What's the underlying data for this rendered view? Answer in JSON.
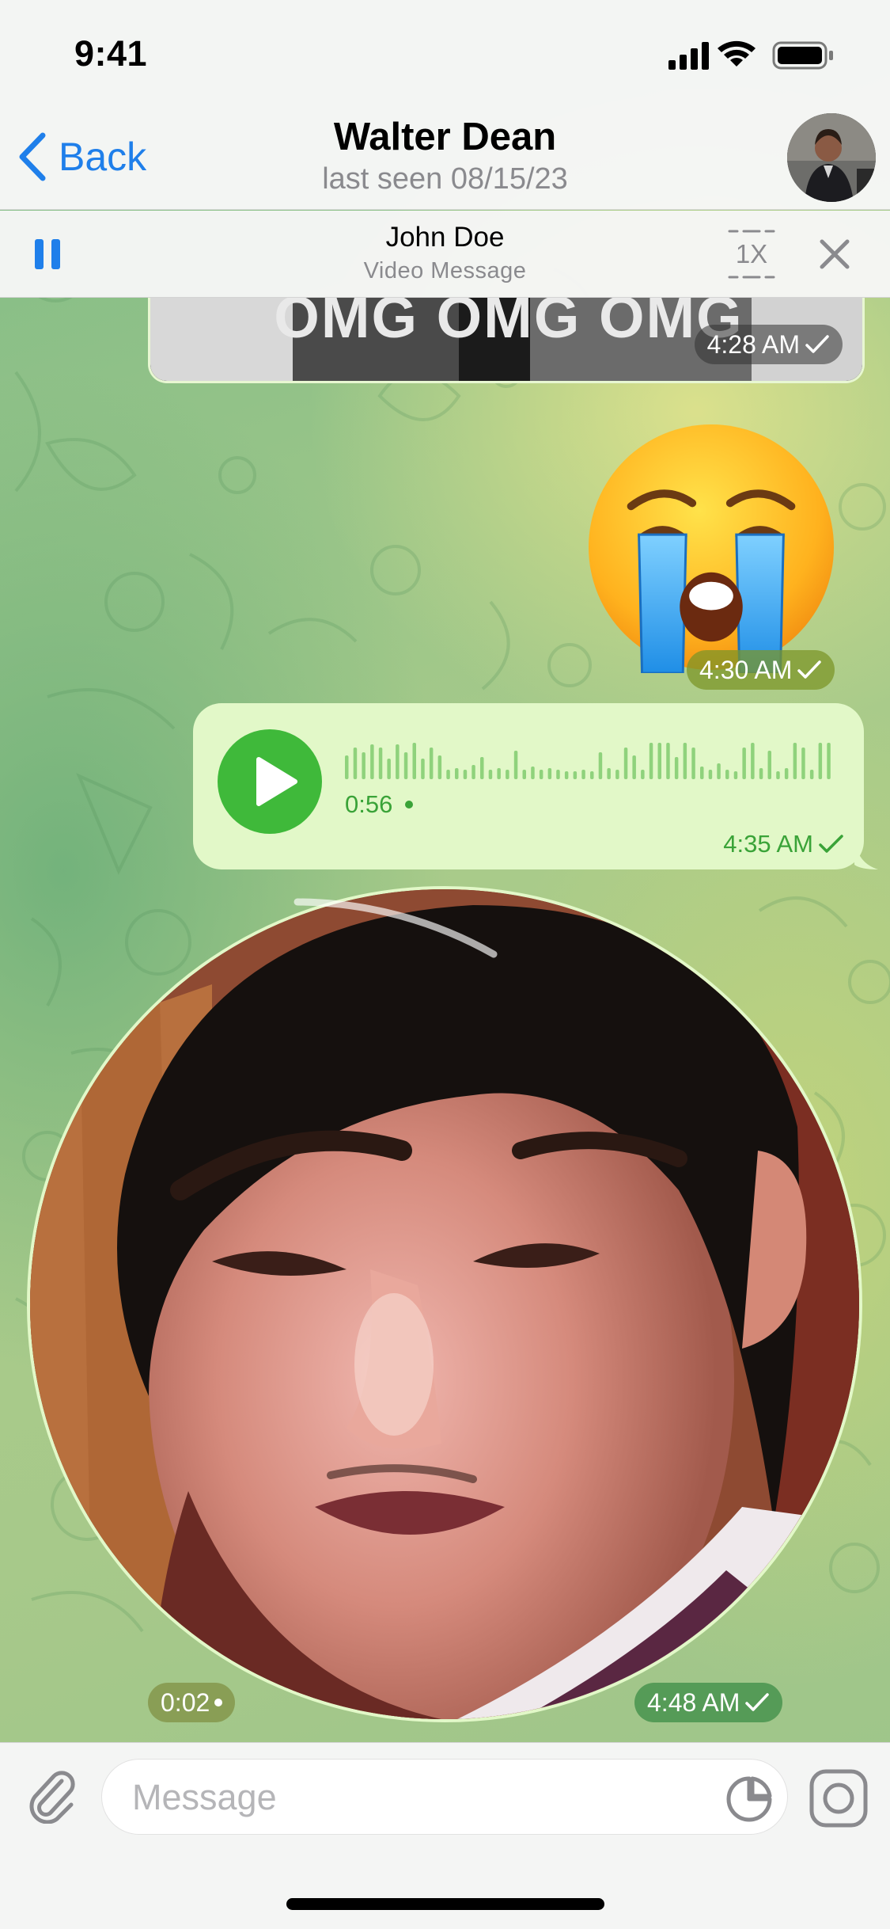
{
  "status_bar": {
    "time": "9:41",
    "icons": [
      "signal-icon",
      "wifi-icon",
      "battery-icon"
    ]
  },
  "header": {
    "back_label": "Back",
    "title": "Walter Dean",
    "subtitle": "last seen 08/15/23",
    "avatar": "contact-avatar"
  },
  "player": {
    "title": "John Doe",
    "subtitle": "Video Message",
    "speed": "1X",
    "state": "playing"
  },
  "messages": [
    {
      "type": "gif",
      "caption": "OMG OMG OMG",
      "time": "4:28 AM",
      "status": "read"
    },
    {
      "type": "sticker",
      "emoji": "loudly-crying-face",
      "time": "4:30 AM",
      "status": "read"
    },
    {
      "type": "voice",
      "duration": "0:56",
      "time": "4:35 AM",
      "status": "read"
    },
    {
      "type": "video-note",
      "elapsed": "0:02",
      "time": "4:48 AM",
      "status": "read",
      "progress": 0.08
    }
  ],
  "input": {
    "placeholder": "Message",
    "value": ""
  },
  "colors": {
    "accent": "#1f7fea",
    "voice_green": "#3fb93a",
    "bubble_out": "#e2f8c8"
  }
}
